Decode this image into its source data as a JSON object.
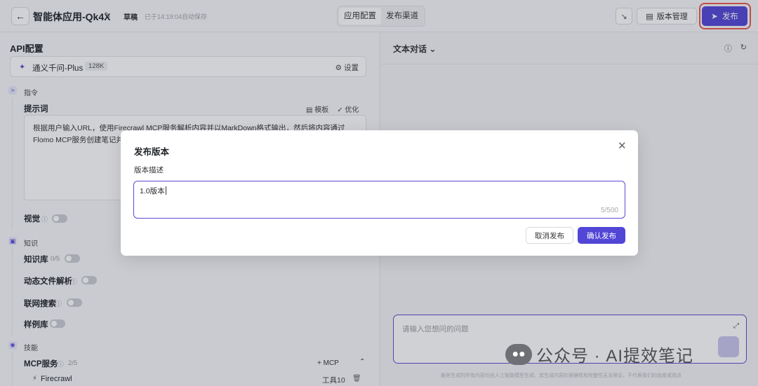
{
  "topbar": {
    "back_icon": "arrow-left-icon",
    "app_title": "智能体应用-Qk4X",
    "edit_icon": "edit-icon",
    "draft": "草稿",
    "autosave": "已于14:19:04自动保存",
    "tabs": [
      "应用配置",
      "发布渠道"
    ],
    "shrink_icon": "shrink-icon",
    "version_label": "版本管理",
    "version_icon": "history-icon",
    "publish_label": "发布",
    "publish_icon": "send-icon",
    "accent": "#5146d6",
    "highlight": "#e85a4f"
  },
  "left": {
    "section_title": "API配置",
    "model": {
      "name": "通义千问-Plus",
      "tag": "128K",
      "settings": "设置",
      "settings_icon": "gear-icon"
    },
    "instruction_group": "指令",
    "prompt_label": "提示词",
    "template_label": "模板",
    "optimize_label": "优化",
    "prompt_text": "根据用户输入URL，使用Firecrawl MCP服务解析内容并以MarkDown格式输出，然后将内容通过Flomo MCP服务创建笔记并",
    "vision_label": "视觉",
    "knowledge_group": "知识",
    "kb_label": "知识库",
    "kb_count": "0/5",
    "file_parse_label": "动态文件解析",
    "web_search_label": "联网搜索",
    "sample_label": "样例库",
    "skills_group": "技能",
    "mcp_label": "MCP服务",
    "mcp_count": "2/5",
    "mcp_add": "+ MCP",
    "mcp_collapse_icon": "chevron-up-icon",
    "mcp_items": [
      {
        "name": "Firecrawl",
        "tools": "工具10"
      }
    ]
  },
  "right": {
    "chat_title": "文本对话",
    "chat_title_icon": "chevron-down-icon",
    "info_icon": "info-icon",
    "refresh_icon": "refresh-icon",
    "input_placeholder": "请输入您想问的问题",
    "expand_icon": "expand-icon",
    "disclaimer": "服务生成的所有内容均由人工智能模型生成，其生成内容的准确性和完整性无法保证，不代表我们的态度或观点"
  },
  "modal": {
    "title": "发布版本",
    "field_label": "版本描述",
    "input_value": "1.0版本",
    "counter": "5/500",
    "cancel_label": "取消发布",
    "confirm_label": "确认发布"
  },
  "watermark": {
    "text": "公众号 · AI提效笔记"
  }
}
